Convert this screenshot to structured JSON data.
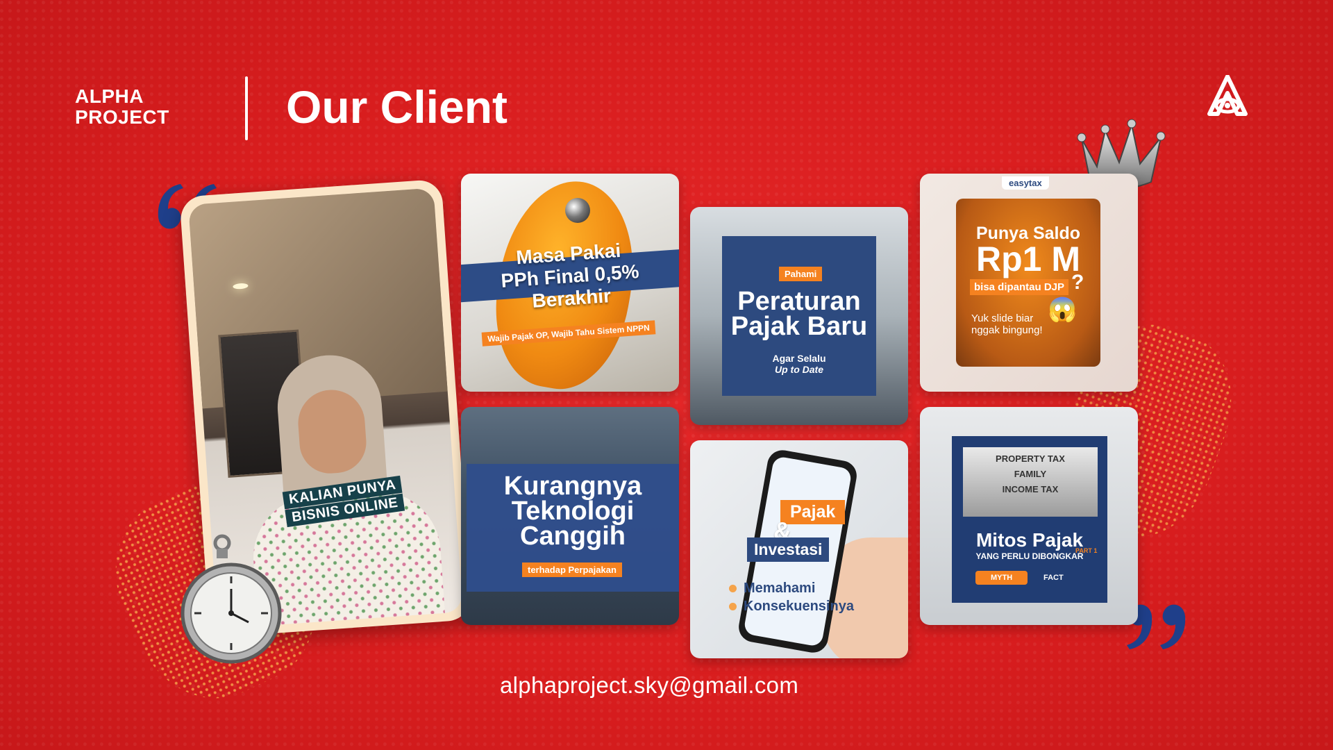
{
  "header": {
    "brand_line1": "ALPHA",
    "brand_line2": "PROJECT",
    "title": "Our Client"
  },
  "testimonial": {
    "caption_line1": "KALIAN PUNYA",
    "caption_line2": "BISNIS ONLINE"
  },
  "cards": {
    "c1": {
      "l1": "Masa Pakai",
      "l2": "PPh Final 0,5%",
      "l3": "Berakhir",
      "sub": "Wajib Pajak OP, Wajib Tahu Sistem NPPN"
    },
    "c2": {
      "l1": "Kurangnya",
      "l2": "Teknologi",
      "l3": "Canggih",
      "tag": "terhadap Perpajakan"
    },
    "c3": {
      "pill": "Pahami",
      "l1": "Peraturan",
      "l2": "Pajak Baru",
      "s1": "Agar Selalu",
      "s2": "Up to Date"
    },
    "c4": {
      "p1": "Pajak",
      "amp": "&",
      "p2": "Investasi",
      "li1": "Memahami",
      "li2": "Konsekuensinya"
    },
    "c5": {
      "badge": "easytax",
      "l1": "Punya Saldo",
      "l2": "Rp1 M",
      "l3": "bisa dipantau DJP",
      "q": "?",
      "s1": "Yuk slide biar",
      "s2": "nggak bingung!",
      "emoji": "😱"
    },
    "c6": {
      "f1": "PROPERTY TAX",
      "f2": "FAMILY",
      "f3": "INCOME TAX",
      "title": "Mitos Pajak",
      "sub": "YANG PERLU DIBONGKAR",
      "part": "PART 1",
      "myth": "MYTH",
      "fact": "FACT"
    }
  },
  "footer": {
    "email": "alphaproject.sky@gmail.com"
  },
  "colors": {
    "background": "#e3211f",
    "accent_orange": "#f58220",
    "navy": "#2d4a7f",
    "quote_blue": "#1f3f8a"
  },
  "icons": [
    "alpha-project-logo-icon",
    "crown-icon",
    "quote-open-icon",
    "quote-close-icon",
    "pocket-watch-icon"
  ]
}
